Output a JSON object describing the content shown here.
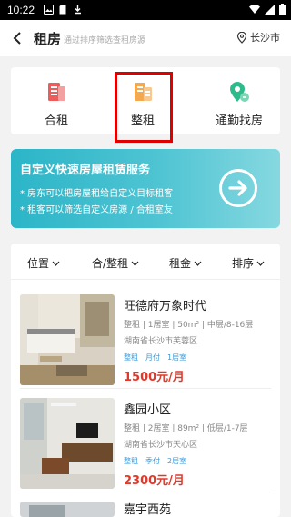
{
  "status_bar": {
    "time": "10:22"
  },
  "header": {
    "title": "租房",
    "subtitle": "通过排序筛选查租房源",
    "location": "长沙市"
  },
  "categories": [
    {
      "label": "合租",
      "icon": "shared-room-icon"
    },
    {
      "label": "整租",
      "icon": "whole-rent-icon"
    },
    {
      "label": "通勤找房",
      "icon": "commute-location-icon"
    }
  ],
  "banner": {
    "title": "自定义快速房屋租赁服务",
    "line1": "* 房东可以把房屋租给自定义目标租客",
    "line2": "* 租客可以筛选自定义房源 / 合租室友"
  },
  "filters": [
    "位置",
    "合/整租",
    "租金",
    "排序"
  ],
  "listings": [
    {
      "name": "旺德府万象时代",
      "spec": "整租 | 1居室 | 50m² | 中层/8-16层",
      "address": "湖南省长沙市芙蓉区",
      "tags": [
        "整租",
        "月付",
        "1居室"
      ],
      "price": "1500元/月"
    },
    {
      "name": "鑫园小区",
      "spec": "整租 | 2居室 | 89m² | 低层/1-7层",
      "address": "湖南省长沙市天心区",
      "tags": [
        "整租",
        "季付",
        "2居室"
      ],
      "price": "2300元/月"
    },
    {
      "name": "嘉宇西苑"
    }
  ],
  "colors": {
    "accent": "#e0392b",
    "banner": "#2bb5c8",
    "tag": "#3a9ad9",
    "highlight": "#e00000"
  }
}
